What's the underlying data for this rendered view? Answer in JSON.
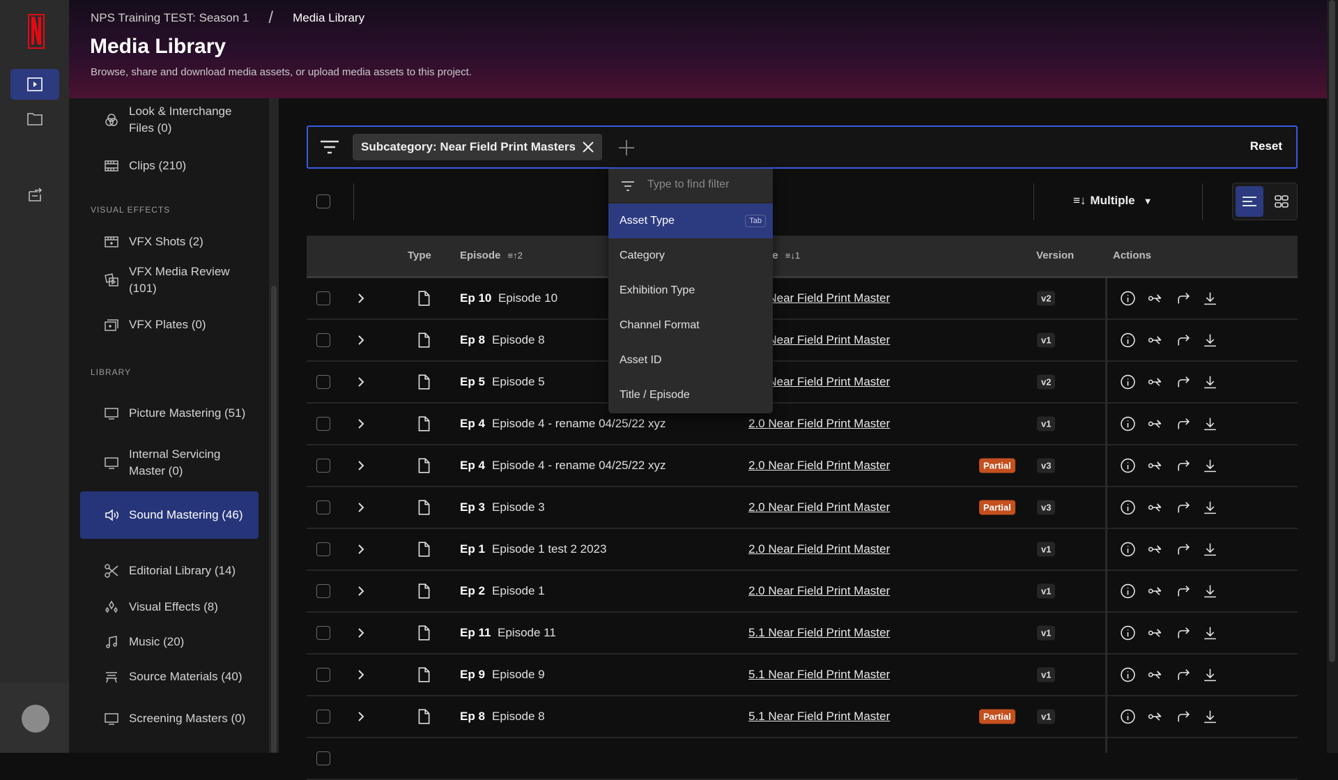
{
  "header": {
    "breadcrumb": [
      "NPS Training TEST: Season 1",
      "Media Library"
    ],
    "breadcrumb_sep": "/",
    "title": "Media Library",
    "subtitle": "Browse, share and download media assets, or upload media assets to this project."
  },
  "rail": {
    "icons": [
      "netflix-logo",
      "media-library-icon",
      "folder-icon",
      "inbox-export-icon"
    ],
    "active": "media-library-icon"
  },
  "sidebar": {
    "sections": [
      {
        "header": "",
        "items": [
          {
            "label": "Look & Interchange Files (0)",
            "icon": "color-circles-icon"
          },
          {
            "label": "Clips (210)",
            "icon": "film-icon"
          }
        ]
      },
      {
        "header": "VISUAL EFFECTS",
        "items": [
          {
            "label": "VFX Shots (2)",
            "icon": "clapper-icon"
          },
          {
            "label": "VFX Media Review (101)",
            "icon": "media-review-icon"
          },
          {
            "label": "VFX Plates (0)",
            "icon": "plates-icon"
          }
        ]
      },
      {
        "header": "LIBRARY",
        "items": [
          {
            "label": "Picture Mastering (51)",
            "icon": "monitor-icon"
          },
          {
            "label": "Internal Servicing Master (0)",
            "icon": "monitor-icon"
          },
          {
            "label": "Sound Mastering (46)",
            "icon": "speaker-icon",
            "active": true
          },
          {
            "label": "Editorial Library (14)",
            "icon": "scissors-icon"
          },
          {
            "label": "Visual Effects (8)",
            "icon": "sparkle-icon"
          },
          {
            "label": "Music (20)",
            "icon": "music-icon"
          },
          {
            "label": "Source Materials (40)",
            "icon": "source-icon"
          },
          {
            "label": "Screening Masters (0)",
            "icon": "monitor-icon"
          }
        ]
      }
    ]
  },
  "filter": {
    "chip_label": "Subcategory: Near Field Print Masters",
    "reset_label": "Reset",
    "accent": "#3a5be0"
  },
  "toolbar": {
    "sort_label": "Multiple",
    "view": "list"
  },
  "dropdown": {
    "placeholder": "Type to find filter",
    "items": [
      "Asset Type",
      "Category",
      "Exhibition Type",
      "Channel Format",
      "Asset ID",
      "Title / Episode"
    ],
    "highlighted": "Asset Type",
    "shortcut": "Tab"
  },
  "table": {
    "columns": {
      "type": "Type",
      "episode": "Episode",
      "episode_sort": "2",
      "title": "Title",
      "title_sort": "1",
      "version": "Version",
      "actions": "Actions"
    },
    "rows": [
      {
        "ep": "Ep 10",
        "name": "Episode 10",
        "title": "2.0 Near Field Print Master",
        "partial": "",
        "version": "v2"
      },
      {
        "ep": "Ep 8",
        "name": "Episode 8",
        "title": "2.0 Near Field Print Master",
        "partial": "",
        "version": "v1"
      },
      {
        "ep": "Ep 5",
        "name": "Episode 5",
        "title": "2.0 Near Field Print Master",
        "partial": "",
        "version": "v2"
      },
      {
        "ep": "Ep 4",
        "name": "Episode 4 - rename 04/25/22 xyz",
        "title": "2.0 Near Field Print Master",
        "partial": "",
        "version": "v1"
      },
      {
        "ep": "Ep 4",
        "name": "Episode 4 - rename 04/25/22 xyz",
        "title": "2.0 Near Field Print Master",
        "partial": "Partial",
        "version": "v3"
      },
      {
        "ep": "Ep 3",
        "name": "Episode 3",
        "title": "2.0 Near Field Print Master",
        "partial": "Partial",
        "version": "v3"
      },
      {
        "ep": "Ep 1",
        "name": "Episode 1 test 2 2023",
        "title": "2.0 Near Field Print Master",
        "partial": "",
        "version": "v1"
      },
      {
        "ep": "Ep 2",
        "name": "Episode 1",
        "title": "2.0 Near Field Print Master",
        "partial": "",
        "version": "v1"
      },
      {
        "ep": "Ep 11",
        "name": "Episode 11",
        "title": "5.1 Near Field Print Master",
        "partial": "",
        "version": "v1"
      },
      {
        "ep": "Ep 9",
        "name": "Episode 9",
        "title": "5.1 Near Field Print Master",
        "partial": "",
        "version": "v1"
      },
      {
        "ep": "Ep 8",
        "name": "Episode 8",
        "title": "5.1 Near Field Print Master",
        "partial": "Partial",
        "version": "v1"
      }
    ],
    "partial_color": "#c4501e"
  }
}
